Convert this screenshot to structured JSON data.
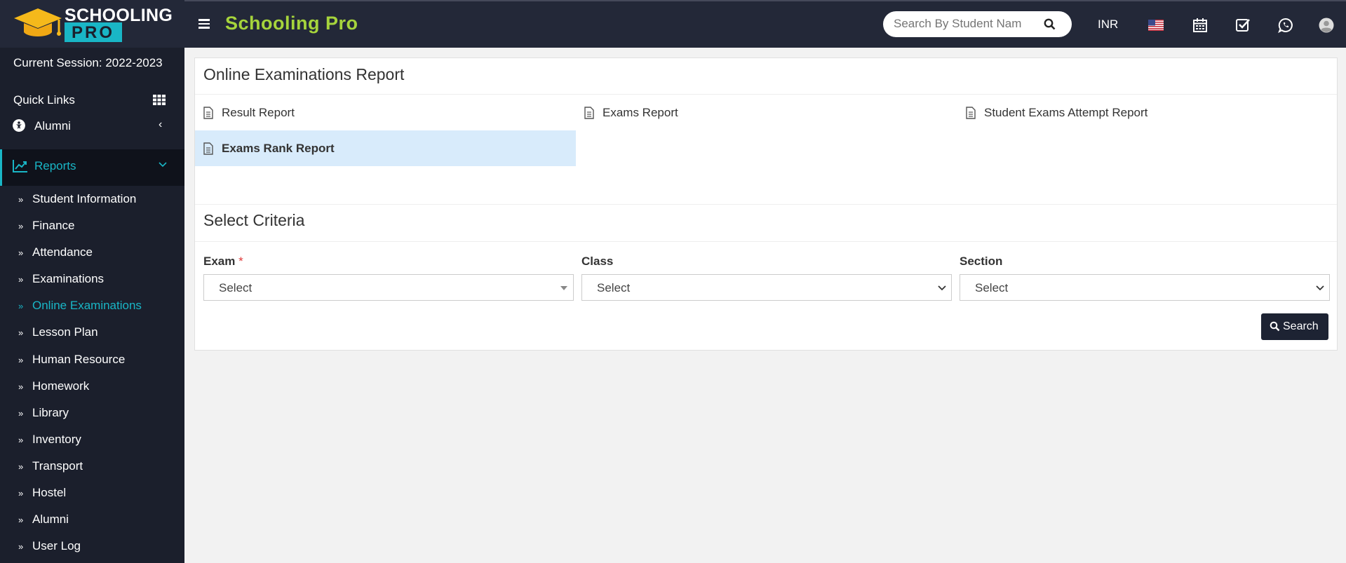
{
  "app": {
    "logo_line1": "SCHOOLING",
    "logo_line2": "PRO",
    "brand": "Schooling Pro"
  },
  "sidebar": {
    "session": "Current Session: 2022-2023",
    "quick_links": "Quick Links",
    "alumni_top": "Alumni",
    "reports": "Reports",
    "submenu": [
      "Student Information",
      "Finance",
      "Attendance",
      "Examinations",
      "Online Examinations",
      "Lesson Plan",
      "Human Resource",
      "Homework",
      "Library",
      "Inventory",
      "Transport",
      "Hostel",
      "Alumni",
      "User Log"
    ],
    "active_submenu": "Online Examinations"
  },
  "topbar": {
    "search_placeholder": "Search By Student Nam",
    "currency": "INR"
  },
  "report_panel": {
    "title": "Online Examinations Report",
    "links": [
      "Result Report",
      "Exams Report",
      "Student Exams Attempt Report",
      "Exams Rank Report"
    ],
    "active_link": "Exams Rank Report"
  },
  "criteria": {
    "title": "Select Criteria",
    "fields": [
      {
        "label": "Exam",
        "required": true,
        "value": "Select"
      },
      {
        "label": "Class",
        "required": false,
        "value": "Select"
      },
      {
        "label": "Section",
        "required": false,
        "value": "Select"
      }
    ],
    "search_button": "Search"
  },
  "colors": {
    "accent": "#19b6c6",
    "brand": "#a6d43c",
    "sidebar_bg": "#1b1f2c",
    "active_row": "#d8ebfb"
  }
}
